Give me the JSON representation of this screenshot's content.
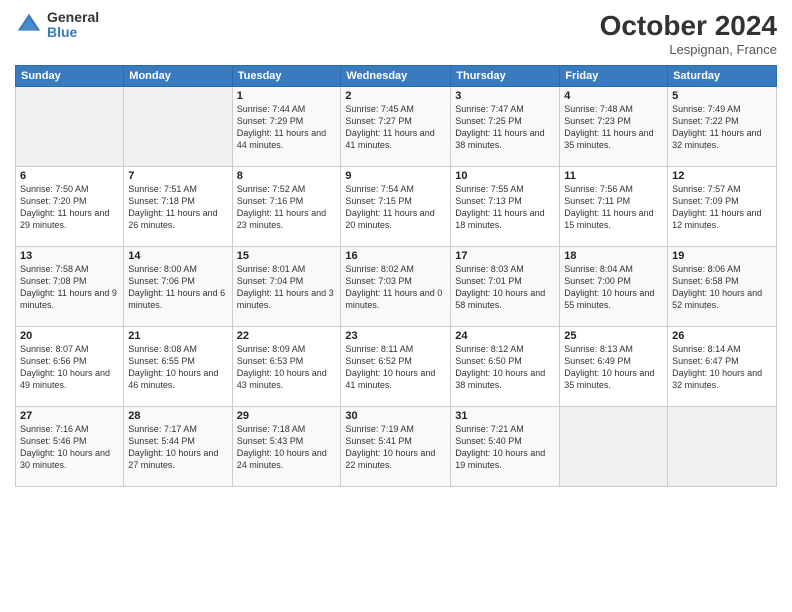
{
  "header": {
    "logo": {
      "general": "General",
      "blue": "Blue"
    },
    "title": "October 2024",
    "location": "Lespignan, France"
  },
  "columns": [
    "Sunday",
    "Monday",
    "Tuesday",
    "Wednesday",
    "Thursday",
    "Friday",
    "Saturday"
  ],
  "weeks": [
    [
      {
        "day": "",
        "sunrise": "",
        "sunset": "",
        "daylight": ""
      },
      {
        "day": "",
        "sunrise": "",
        "sunset": "",
        "daylight": ""
      },
      {
        "day": "1",
        "sunrise": "Sunrise: 7:44 AM",
        "sunset": "Sunset: 7:29 PM",
        "daylight": "Daylight: 11 hours and 44 minutes."
      },
      {
        "day": "2",
        "sunrise": "Sunrise: 7:45 AM",
        "sunset": "Sunset: 7:27 PM",
        "daylight": "Daylight: 11 hours and 41 minutes."
      },
      {
        "day": "3",
        "sunrise": "Sunrise: 7:47 AM",
        "sunset": "Sunset: 7:25 PM",
        "daylight": "Daylight: 11 hours and 38 minutes."
      },
      {
        "day": "4",
        "sunrise": "Sunrise: 7:48 AM",
        "sunset": "Sunset: 7:23 PM",
        "daylight": "Daylight: 11 hours and 35 minutes."
      },
      {
        "day": "5",
        "sunrise": "Sunrise: 7:49 AM",
        "sunset": "Sunset: 7:22 PM",
        "daylight": "Daylight: 11 hours and 32 minutes."
      }
    ],
    [
      {
        "day": "6",
        "sunrise": "Sunrise: 7:50 AM",
        "sunset": "Sunset: 7:20 PM",
        "daylight": "Daylight: 11 hours and 29 minutes."
      },
      {
        "day": "7",
        "sunrise": "Sunrise: 7:51 AM",
        "sunset": "Sunset: 7:18 PM",
        "daylight": "Daylight: 11 hours and 26 minutes."
      },
      {
        "day": "8",
        "sunrise": "Sunrise: 7:52 AM",
        "sunset": "Sunset: 7:16 PM",
        "daylight": "Daylight: 11 hours and 23 minutes."
      },
      {
        "day": "9",
        "sunrise": "Sunrise: 7:54 AM",
        "sunset": "Sunset: 7:15 PM",
        "daylight": "Daylight: 11 hours and 20 minutes."
      },
      {
        "day": "10",
        "sunrise": "Sunrise: 7:55 AM",
        "sunset": "Sunset: 7:13 PM",
        "daylight": "Daylight: 11 hours and 18 minutes."
      },
      {
        "day": "11",
        "sunrise": "Sunrise: 7:56 AM",
        "sunset": "Sunset: 7:11 PM",
        "daylight": "Daylight: 11 hours and 15 minutes."
      },
      {
        "day": "12",
        "sunrise": "Sunrise: 7:57 AM",
        "sunset": "Sunset: 7:09 PM",
        "daylight": "Daylight: 11 hours and 12 minutes."
      }
    ],
    [
      {
        "day": "13",
        "sunrise": "Sunrise: 7:58 AM",
        "sunset": "Sunset: 7:08 PM",
        "daylight": "Daylight: 11 hours and 9 minutes."
      },
      {
        "day": "14",
        "sunrise": "Sunrise: 8:00 AM",
        "sunset": "Sunset: 7:06 PM",
        "daylight": "Daylight: 11 hours and 6 minutes."
      },
      {
        "day": "15",
        "sunrise": "Sunrise: 8:01 AM",
        "sunset": "Sunset: 7:04 PM",
        "daylight": "Daylight: 11 hours and 3 minutes."
      },
      {
        "day": "16",
        "sunrise": "Sunrise: 8:02 AM",
        "sunset": "Sunset: 7:03 PM",
        "daylight": "Daylight: 11 hours and 0 minutes."
      },
      {
        "day": "17",
        "sunrise": "Sunrise: 8:03 AM",
        "sunset": "Sunset: 7:01 PM",
        "daylight": "Daylight: 10 hours and 58 minutes."
      },
      {
        "day": "18",
        "sunrise": "Sunrise: 8:04 AM",
        "sunset": "Sunset: 7:00 PM",
        "daylight": "Daylight: 10 hours and 55 minutes."
      },
      {
        "day": "19",
        "sunrise": "Sunrise: 8:06 AM",
        "sunset": "Sunset: 6:58 PM",
        "daylight": "Daylight: 10 hours and 52 minutes."
      }
    ],
    [
      {
        "day": "20",
        "sunrise": "Sunrise: 8:07 AM",
        "sunset": "Sunset: 6:56 PM",
        "daylight": "Daylight: 10 hours and 49 minutes."
      },
      {
        "day": "21",
        "sunrise": "Sunrise: 8:08 AM",
        "sunset": "Sunset: 6:55 PM",
        "daylight": "Daylight: 10 hours and 46 minutes."
      },
      {
        "day": "22",
        "sunrise": "Sunrise: 8:09 AM",
        "sunset": "Sunset: 6:53 PM",
        "daylight": "Daylight: 10 hours and 43 minutes."
      },
      {
        "day": "23",
        "sunrise": "Sunrise: 8:11 AM",
        "sunset": "Sunset: 6:52 PM",
        "daylight": "Daylight: 10 hours and 41 minutes."
      },
      {
        "day": "24",
        "sunrise": "Sunrise: 8:12 AM",
        "sunset": "Sunset: 6:50 PM",
        "daylight": "Daylight: 10 hours and 38 minutes."
      },
      {
        "day": "25",
        "sunrise": "Sunrise: 8:13 AM",
        "sunset": "Sunset: 6:49 PM",
        "daylight": "Daylight: 10 hours and 35 minutes."
      },
      {
        "day": "26",
        "sunrise": "Sunrise: 8:14 AM",
        "sunset": "Sunset: 6:47 PM",
        "daylight": "Daylight: 10 hours and 32 minutes."
      }
    ],
    [
      {
        "day": "27",
        "sunrise": "Sunrise: 7:16 AM",
        "sunset": "Sunset: 5:46 PM",
        "daylight": "Daylight: 10 hours and 30 minutes."
      },
      {
        "day": "28",
        "sunrise": "Sunrise: 7:17 AM",
        "sunset": "Sunset: 5:44 PM",
        "daylight": "Daylight: 10 hours and 27 minutes."
      },
      {
        "day": "29",
        "sunrise": "Sunrise: 7:18 AM",
        "sunset": "Sunset: 5:43 PM",
        "daylight": "Daylight: 10 hours and 24 minutes."
      },
      {
        "day": "30",
        "sunrise": "Sunrise: 7:19 AM",
        "sunset": "Sunset: 5:41 PM",
        "daylight": "Daylight: 10 hours and 22 minutes."
      },
      {
        "day": "31",
        "sunrise": "Sunrise: 7:21 AM",
        "sunset": "Sunset: 5:40 PM",
        "daylight": "Daylight: 10 hours and 19 minutes."
      },
      {
        "day": "",
        "sunrise": "",
        "sunset": "",
        "daylight": ""
      },
      {
        "day": "",
        "sunrise": "",
        "sunset": "",
        "daylight": ""
      }
    ]
  ]
}
